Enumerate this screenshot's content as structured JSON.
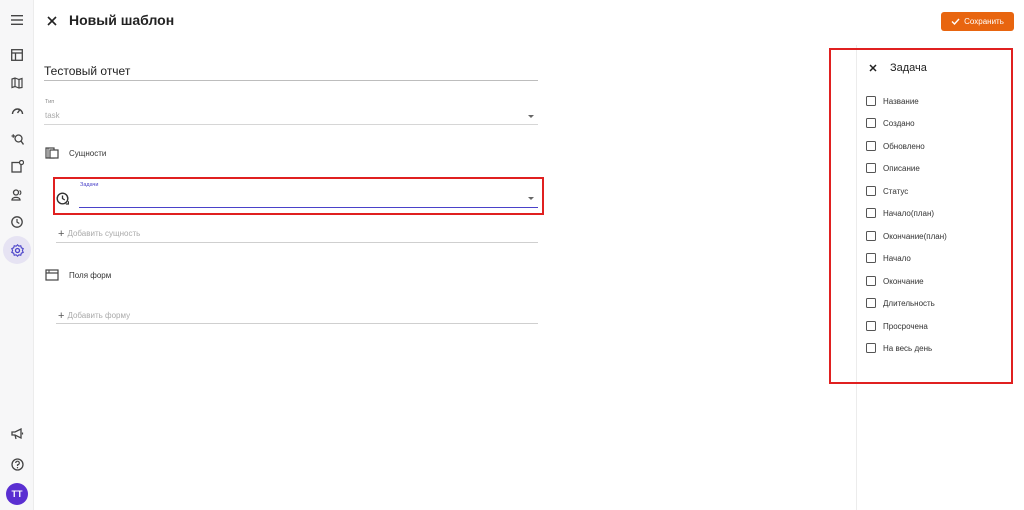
{
  "header": {
    "title": "Новый шаблон",
    "save_label": "Сохранить"
  },
  "colors": {
    "accent": "#e8650f",
    "primary": "#4a42c9",
    "avatar": "#5a2fd1",
    "highlight_border": "#e02020"
  },
  "nav": {
    "icons": [
      "menu-icon",
      "table-icon",
      "map-icon",
      "gauge-icon",
      "search-plus-icon",
      "notification-square-icon",
      "users-icon",
      "clock-icon",
      "settings-icon"
    ],
    "bottom_icons": [
      "megaphone-icon",
      "help-icon"
    ],
    "avatar_initials": "TT"
  },
  "form": {
    "report_name": "Тестовый отчет",
    "type_label": "Тип",
    "type_value": "task",
    "entities_section": "Сущности",
    "entity_label": "Задачи",
    "entity_value": "",
    "add_entity": "Добавить сущность",
    "form_fields_section": "Поля форм",
    "add_form": "Добавить форму"
  },
  "panel": {
    "title": "Задача",
    "fields": [
      {
        "label": "Название",
        "checked": false
      },
      {
        "label": "Создано",
        "checked": false
      },
      {
        "label": "Обновлено",
        "checked": false
      },
      {
        "label": "Описание",
        "checked": false
      },
      {
        "label": "Статус",
        "checked": false
      },
      {
        "label": "Начало(план)",
        "checked": false
      },
      {
        "label": "Окончание(план)",
        "checked": false
      },
      {
        "label": "Начало",
        "checked": false
      },
      {
        "label": "Окончание",
        "checked": false
      },
      {
        "label": "Длительность",
        "checked": false
      },
      {
        "label": "Просрочена",
        "checked": false
      },
      {
        "label": "На весь день",
        "checked": false
      }
    ]
  }
}
